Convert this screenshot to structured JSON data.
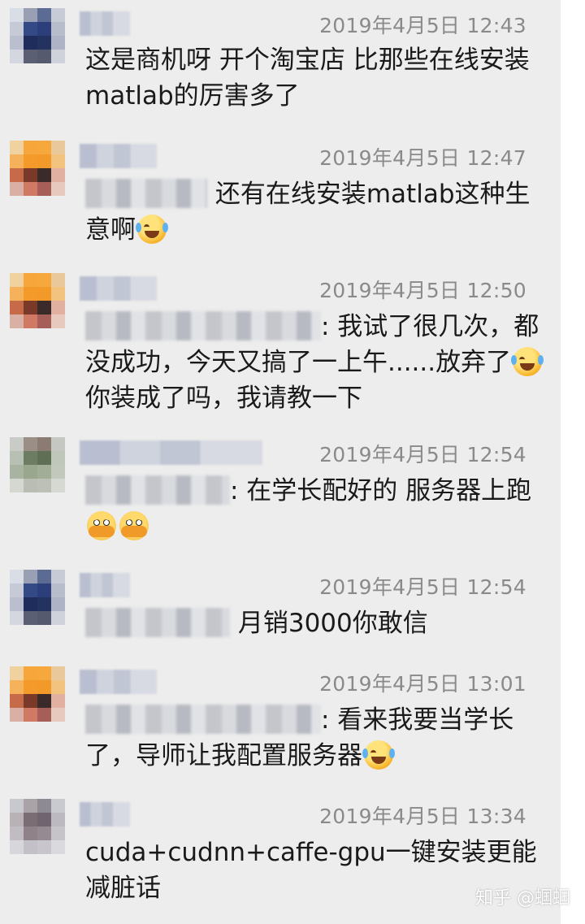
{
  "messages": [
    {
      "time": "2019年4月5日 12:43",
      "text": "这是商机呀 开个淘宝店 比那些在线安装matlab的厉害多了",
      "prefix": "",
      "emojis": [],
      "avatar": [
        "#d9dde6",
        "#9aa0b3",
        "#5c6b93",
        "#c7cbd6",
        "#c6cad7",
        "#334a86",
        "#2c3f7a",
        "#b8bdcc",
        "#b9bfcf",
        "#1f2d5c",
        "#24325f",
        "#aeb4c5",
        "#d4d7df",
        "#5a5f74",
        "#555a6e",
        "#cfd2db"
      ]
    },
    {
      "time": "2019年4月5日 12:47",
      "prefix_text": "还有在线安装matlab这种生意啊",
      "text": "",
      "emojis": [
        "tear"
      ],
      "avatar": [
        "#f0d2a0",
        "#f6a63a",
        "#f7a83d",
        "#e9c89c",
        "#f5b25a",
        "#f39a2b",
        "#f19a29",
        "#f2c27f",
        "#c76a48",
        "#7a3a2a",
        "#3a2a2a",
        "#e2b0a0",
        "#d8b0a4",
        "#d07a66",
        "#a65e58",
        "#e7c9bd"
      ]
    },
    {
      "time": "2019年4月5日 12:50",
      "prefix_text": ": 我试了很几次，都没成功，今天又搞了一上午......放弃了",
      "suffix": "你装成了吗，我请教一下",
      "emojis": [
        "tear"
      ],
      "avatar": [
        "#f0d2a0",
        "#f6a63a",
        "#f7a83d",
        "#e9c89c",
        "#f5b25a",
        "#f39a2b",
        "#f19a29",
        "#f2c27f",
        "#c76a48",
        "#7a3a2a",
        "#3a2a2a",
        "#e2b0a0",
        "#d8b0a4",
        "#d07a66",
        "#a65e58",
        "#e7c9bd"
      ]
    },
    {
      "time": "2019年4月5日 12:54",
      "prefix_text": ": 在学长配好的 服务器上跑",
      "emojis": [
        "peek",
        "peek"
      ],
      "avatar": [
        "#c9cbc6",
        "#9a8e86",
        "#8c7b72",
        "#c5c7c2",
        "#b7c0b3",
        "#6c7d63",
        "#5e6f55",
        "#bfc7ba",
        "#a8b3a1",
        "#9aa78f",
        "#a2ad97",
        "#c2c8bc",
        "#d5d8d1",
        "#b9bdb4",
        "#bcc0b7",
        "#d6d8d2"
      ]
    },
    {
      "time": "2019年4月5日 12:54",
      "prefix_text": "月销3000你敢信",
      "emojis": [],
      "avatar": [
        "#d9dde6",
        "#9aa0b3",
        "#5c6b93",
        "#c7cbd6",
        "#c6cad7",
        "#334a86",
        "#2c3f7a",
        "#b8bdcc",
        "#b9bfcf",
        "#1f2d5c",
        "#24325f",
        "#aeb4c5",
        "#d4d7df",
        "#5a5f74",
        "#555a6e",
        "#cfd2db"
      ]
    },
    {
      "time": "2019年4月5日 13:01",
      "prefix_text": ": 看来我要当学长了，导师让我配置服务器",
      "emojis": [
        "tear"
      ],
      "avatar": [
        "#f0d2a0",
        "#f6a63a",
        "#f7a83d",
        "#e9c89c",
        "#f5b25a",
        "#f39a2b",
        "#f19a29",
        "#f2c27f",
        "#c76a48",
        "#7a3a2a",
        "#3a2a2a",
        "#e2b0a0",
        "#d8b0a4",
        "#d07a66",
        "#a65e58",
        "#e7c9bd"
      ]
    },
    {
      "time": "2019年4月5日 13:34",
      "text": "cuda+cudnn+caffe-gpu一键安装更能减脏话",
      "emojis": [],
      "avatar": [
        "#c8c9cf",
        "#a9a3a8",
        "#8d8a93",
        "#c9cad0",
        "#b8b2b7",
        "#7a6d73",
        "#6f6470",
        "#bdb9c0",
        "#c1bcc2",
        "#8f8289",
        "#958a92",
        "#c6c3c9",
        "#d7d6db",
        "#c3c1c7",
        "#c8c6cc",
        "#dad9de"
      ]
    }
  ],
  "watermark": "知乎 @蝈蝈"
}
